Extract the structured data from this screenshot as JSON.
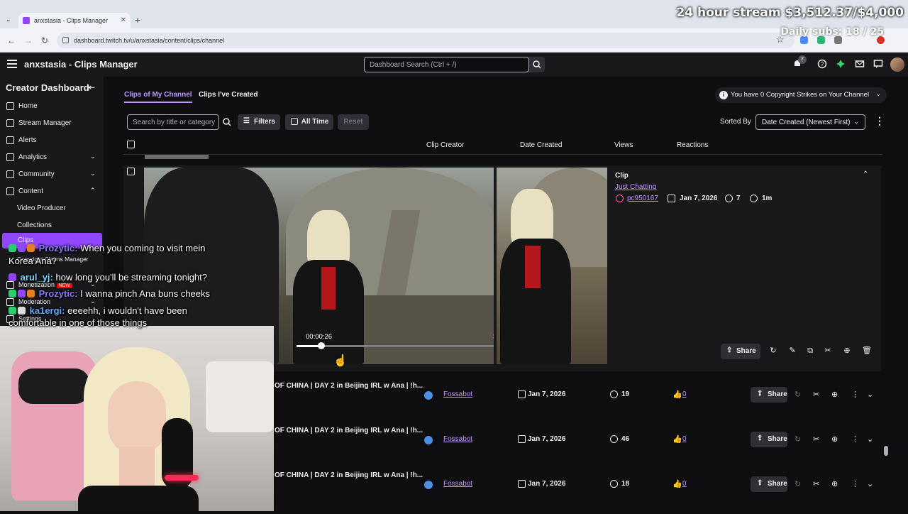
{
  "browser": {
    "tab_title": "anxstasia - Clips Manager",
    "url": "dashboard.twitch.tv/u/anxstasia/content/clips/channel"
  },
  "overlay": {
    "goal_text": "24 hour stream $3,512.37/$4,000",
    "subs_text": "Daily subs: 18 / 25"
  },
  "topbar": {
    "title": "anxstasia - Clips Manager",
    "search_placeholder": "Dashboard Search (Ctrl + /)",
    "notification_count": "2"
  },
  "sidebar": {
    "title": "Creator Dashboard",
    "items": [
      {
        "label": "Home"
      },
      {
        "label": "Stream Manager"
      },
      {
        "label": "Alerts"
      },
      {
        "label": "Analytics"
      },
      {
        "label": "Community"
      },
      {
        "label": "Content"
      }
    ],
    "sub_items": [
      {
        "label": "Video Producer"
      },
      {
        "label": "Collections"
      },
      {
        "label": "Clips"
      },
      {
        "label": "Copyright Claims Manager"
      }
    ],
    "lower_items": [
      {
        "label": "Monetization",
        "badge": "NEW"
      },
      {
        "label": "Moderation"
      },
      {
        "label": "Settings"
      }
    ]
  },
  "main": {
    "tabs": [
      {
        "label": "Clips of My Channel"
      },
      {
        "label": "Clips I've Created"
      }
    ],
    "copyright_notice": "You have 0 Copyright Strikes on Your Channel",
    "search_placeholder": "Search by title or category",
    "filters_label": "Filters",
    "time_label": "All Time",
    "reset_label": "Reset",
    "sorted_by_label": "Sorted By",
    "sort_value": "Date Created (Newest First)",
    "columns": [
      "Clip Creator",
      "Date Created",
      "Views",
      "Reactions"
    ],
    "expanded_clip": {
      "label": "Clip",
      "category": "Just Chatting",
      "creator": "pc950167",
      "date": "Jan 7, 2026",
      "views": "7",
      "duration": "1m",
      "current_time": "00:00:26",
      "end_time": "33",
      "progress": 0.12,
      "share_label": "Share"
    },
    "rows": [
      {
        "title": "OF CHINA | DAY 2 in Beijing IRL w Ana | !h...",
        "creator": "Fossabot",
        "date": "Jan 7, 2026",
        "views": "19",
        "reactions": "0",
        "share": "Share"
      },
      {
        "title": "OF CHINA | DAY 2 in Beijing IRL w Ana | !h...",
        "creator": "Fossabot",
        "date": "Jan 7, 2026",
        "views": "46",
        "reactions": "0",
        "share": "Share"
      },
      {
        "title": "OF CHINA | DAY 2 in Beijing IRL w Ana | !h...",
        "creator": "Fossabot",
        "date": "Jan 7, 2026",
        "views": "18",
        "reactions": "0",
        "share": "Share"
      }
    ]
  },
  "chat": [
    {
      "name": "Prozytic:",
      "text": "When you coming to visit mein",
      "color": "#8a7bff"
    },
    {
      "name": "",
      "text": "Korea Ana?",
      "color": "#ffffff"
    },
    {
      "name": "arul_yj:",
      "text": "how long you'll be streaming tonight?",
      "color": "#7ad7ff"
    },
    {
      "name": "Prozytic:",
      "text": "I wanna pinch Ana buns cheeks",
      "color": "#8a7bff"
    },
    {
      "name": "ka1ergi:",
      "text": "eeeehh, i wouldn't have been",
      "color": "#6aa9ff"
    },
    {
      "name": "",
      "text": "comfortable in one of those things",
      "color": "#ffffff"
    }
  ],
  "colors": {
    "accent": "#9146ff",
    "link": "#bf94ff",
    "bg": "#0e0e10",
    "panel": "#18181b"
  }
}
